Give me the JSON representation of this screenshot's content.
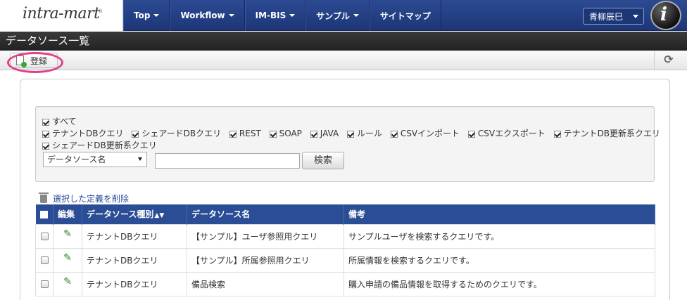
{
  "header": {
    "logo_text": "intra-mart",
    "logo_mark": "®",
    "nav": [
      {
        "label": "Top"
      },
      {
        "label": "Workflow"
      },
      {
        "label": "IM-BIS"
      },
      {
        "label": "サンプル"
      },
      {
        "label": "サイトマップ"
      }
    ],
    "user_name": "青柳辰巳",
    "avatar_letter": "i"
  },
  "title": "データソース一覧",
  "toolbar": {
    "register_label": "登録",
    "refresh_icon": "refresh-icon"
  },
  "filters": {
    "all_label": "すべて",
    "row1": [
      {
        "label": "テナントDBクエリ",
        "checked": true
      },
      {
        "label": "シェアードDBクエリ",
        "checked": true
      },
      {
        "label": "REST",
        "checked": true
      },
      {
        "label": "SOAP",
        "checked": true
      },
      {
        "label": "JAVA",
        "checked": true
      },
      {
        "label": "ルール",
        "checked": true
      },
      {
        "label": "CSVインポート",
        "checked": true
      },
      {
        "label": "CSVエクスポート",
        "checked": true
      },
      {
        "label": "テナントDB更新系クエリ",
        "checked": true
      }
    ],
    "row2": [
      {
        "label": "シェアードDB更新系クエリ",
        "checked": true
      }
    ],
    "select_value": "データソース名",
    "search_value": "",
    "search_button": "検索"
  },
  "delete_link": "選択した定義を削除",
  "table": {
    "headers": {
      "edit": "編集",
      "type": "データソース種別",
      "sort_icon": "▲▼",
      "name": "データソース名",
      "note": "備考"
    },
    "rows": [
      {
        "type": "テナントDBクエリ",
        "name": "【サンプル】ユーザ参照用クエリ",
        "note": "サンプルユーザを検索するクエリです。"
      },
      {
        "type": "テナントDBクエリ",
        "name": "【サンプル】所属参照用クエリ",
        "note": "所属情報を検索するクエリです。"
      },
      {
        "type": "テナントDBクエリ",
        "name": "備品検索",
        "note": "購入申請の備品情報を取得するためのクエリです。"
      }
    ]
  },
  "colors": {
    "header_blue": "#1d3677",
    "table_header": "#2a4d95",
    "highlight": "#e0408a",
    "link": "#2a4d9c"
  }
}
